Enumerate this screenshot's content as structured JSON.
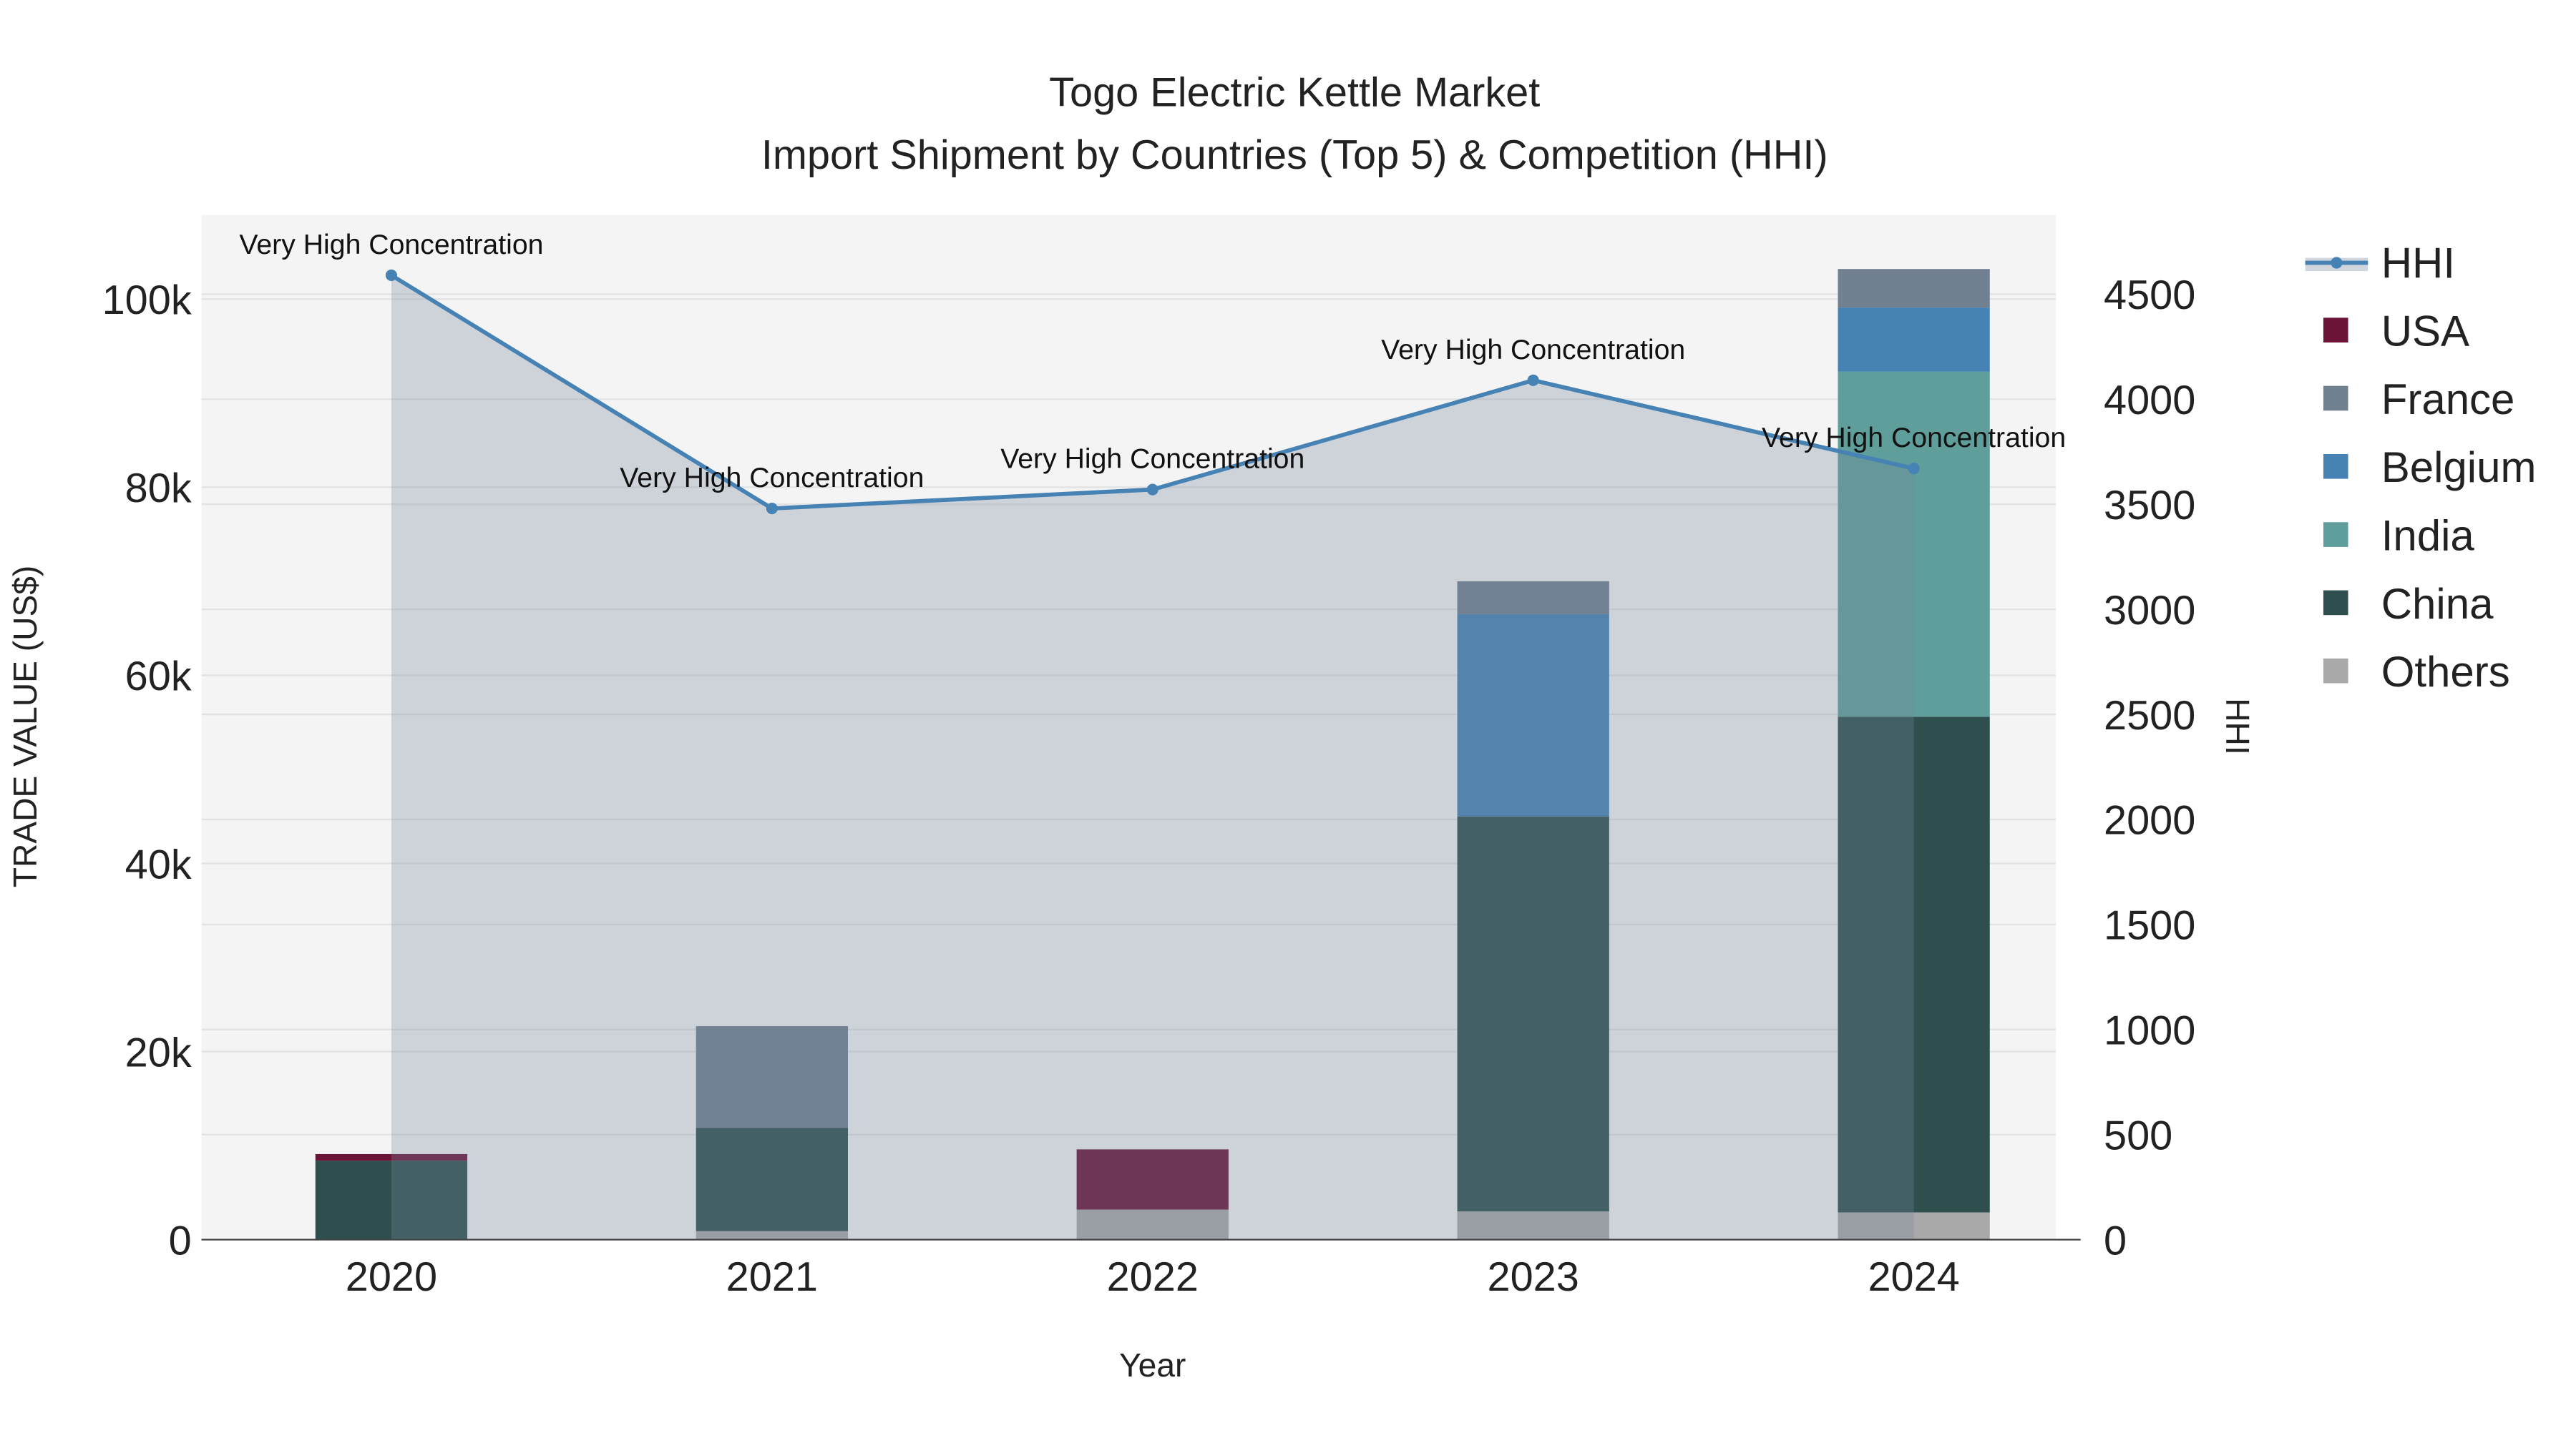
{
  "chart_data": {
    "type": "bar",
    "title": "Togo Electric Kettle Market",
    "subtitle": "Import Shipment by Countries (Top 5) & Competition (HHI)",
    "xlabel": "Year",
    "ylabel": "TRADE VALUE (US$)",
    "y2label": "HHI",
    "categories": [
      "2020",
      "2021",
      "2022",
      "2023",
      "2024"
    ],
    "ylim": [
      0,
      108000
    ],
    "y2lim": [
      0,
      4860
    ],
    "yticks": [
      0,
      20000,
      40000,
      60000,
      80000,
      100000
    ],
    "ytick_labels": [
      "0",
      "20k",
      "40k",
      "60k",
      "80k",
      "100k"
    ],
    "y2ticks": [
      0,
      500,
      1000,
      1500,
      2000,
      2500,
      3000,
      3500,
      4000,
      4500
    ],
    "y2tick_labels": [
      "0",
      "500",
      "1000",
      "1500",
      "2000",
      "2500",
      "3000",
      "3500",
      "4000",
      "4500"
    ],
    "stacking": "stacked",
    "series": [
      {
        "name": "Others",
        "color": "#a9a9a9",
        "values": [
          0,
          900,
          3200,
          3000,
          2900
        ]
      },
      {
        "name": "China",
        "color": "#2f4f4f",
        "values": [
          8400,
          11000,
          0,
          42000,
          52700
        ]
      },
      {
        "name": "India",
        "color": "#5f9e9a",
        "values": [
          0,
          0,
          0,
          0,
          36700
        ]
      },
      {
        "name": "Belgium",
        "color": "#4682b4",
        "values": [
          0,
          0,
          0,
          21500,
          6800
        ]
      },
      {
        "name": "France",
        "color": "#708090",
        "values": [
          0,
          10800,
          0,
          3500,
          4100
        ]
      },
      {
        "name": "USA",
        "color": "#6b1438",
        "values": [
          700,
          0,
          6400,
          0,
          0
        ]
      }
    ],
    "hhi": {
      "name": "HHI",
      "color": "#4682b4",
      "values": [
        4590,
        3480,
        3570,
        4090,
        3670
      ],
      "annotations": [
        "Very High Concentration",
        "Very High Concentration",
        "Very High Concentration",
        "Very High Concentration",
        "Very High Concentration"
      ]
    },
    "legend": {
      "placement": "right",
      "entries": [
        "HHI",
        "USA",
        "France",
        "Belgium",
        "India",
        "China",
        "Others"
      ],
      "colors": [
        "#4682b4",
        "#6b1438",
        "#708090",
        "#4682b4",
        "#5f9e9a",
        "#2f4f4f",
        "#a9a9a9"
      ]
    },
    "grid": true
  }
}
